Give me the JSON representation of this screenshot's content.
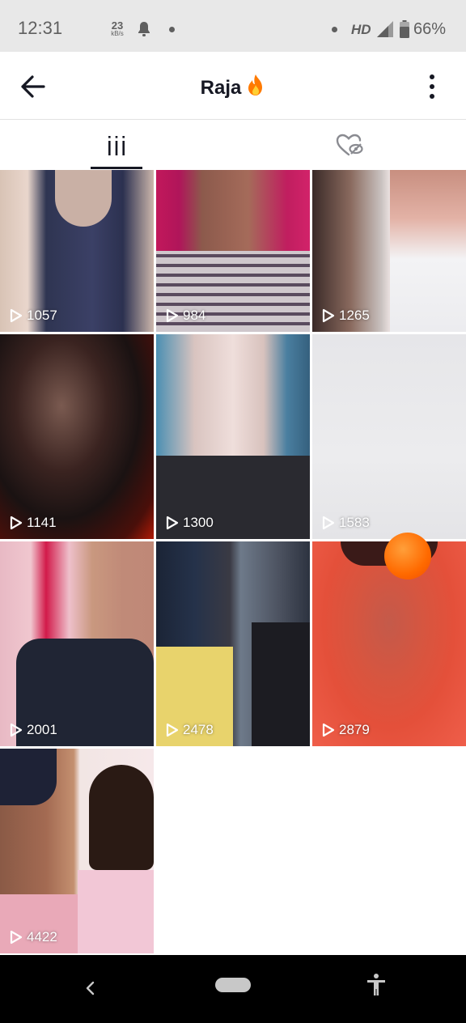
{
  "status_bar": {
    "time": "12:31",
    "net_speed_value": "23",
    "net_speed_unit": "kB/s",
    "network_type": "HD",
    "battery": "66%"
  },
  "header": {
    "title": "Raja",
    "title_emoji": "fire"
  },
  "tabs": [
    {
      "name": "videos",
      "icon": "grid-icon",
      "active": true
    },
    {
      "name": "liked",
      "icon": "heart-hidden-icon",
      "active": false
    }
  ],
  "videos": [
    {
      "views": "1057"
    },
    {
      "views": "984"
    },
    {
      "views": "1265"
    },
    {
      "views": "1141"
    },
    {
      "views": "1300"
    },
    {
      "views": "1583"
    },
    {
      "views": "2001"
    },
    {
      "views": "2478"
    },
    {
      "views": "2879"
    },
    {
      "views": "4422"
    }
  ],
  "colors": {
    "accent_orange": "#ff6a00",
    "text_dark": "#161823",
    "nav_bar": "#000000"
  }
}
